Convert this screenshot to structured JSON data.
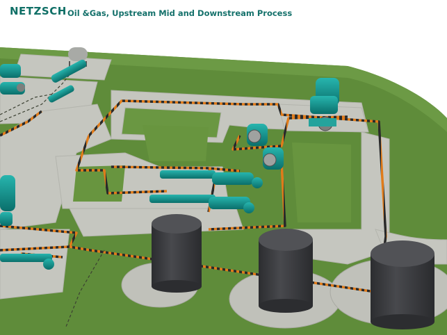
{
  "header": {
    "brand": "NETZSCH",
    "subtitle": "Oil &Gas, Upstream Mid and Downstream Process"
  },
  "colors": {
    "brand": "#0f6f66",
    "ground": "#5e8a3b",
    "pad": "#c4c5bd",
    "pipe": "#e07b1a",
    "pump": "#0e8d8a",
    "tank": "#3c3d40"
  },
  "icons": [
    "progressive-cavity-pump-icon",
    "storage-tank-icon",
    "pipeline-icon",
    "gas-tank-icon"
  ]
}
